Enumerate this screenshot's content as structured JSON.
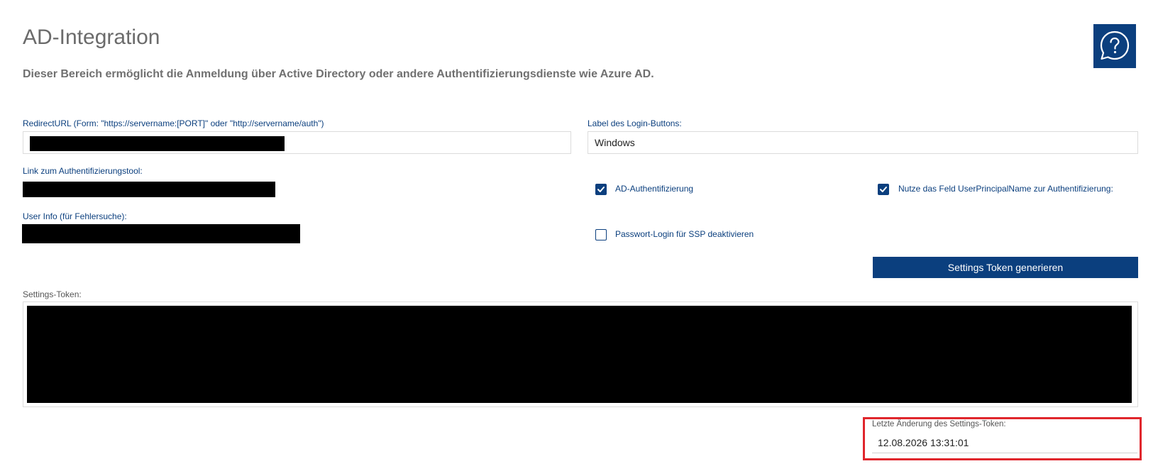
{
  "page": {
    "title": "AD-Integration",
    "description": "Dieser Bereich ermöglicht die Anmeldung über Active Directory oder andere Authentifizierungsdienste wie Azure AD."
  },
  "help": {
    "icon": "question-speech-bubble-icon"
  },
  "fields": {
    "redirect_url": {
      "label": "RedirectURL (Form: \"https://servername:[PORT]\" oder \"http://servername/auth\")",
      "value": "[redacted]"
    },
    "login_button_label": {
      "label": "Label des Login-Buttons:",
      "value": "Windows"
    },
    "auth_tool_link": {
      "label": "Link zum Authentifizierungstool:",
      "value": "[redacted]"
    },
    "user_info": {
      "label": "User Info (für Fehlersuche):",
      "value": "[redacted]"
    },
    "settings_token": {
      "label": "Settings-Token:",
      "value": "[redacted]"
    },
    "last_change": {
      "label": "Letzte Änderung des Settings-Token:",
      "value": "12.08.2026 13:31:01"
    }
  },
  "checkboxes": {
    "ad_auth": {
      "label": "AD-Authentifizierung",
      "checked": true
    },
    "upn": {
      "label": "Nutze das Feld UserPrincipalName zur Authentifizierung:",
      "checked": true
    },
    "disable_password_login": {
      "label": "Passwort-Login für SSP deaktivieren",
      "checked": false
    }
  },
  "actions": {
    "generate_token": "Settings Token generieren"
  },
  "colors": {
    "primary": "#0b3f7e",
    "highlight": "#e0262c",
    "title": "#6b6b6b"
  }
}
